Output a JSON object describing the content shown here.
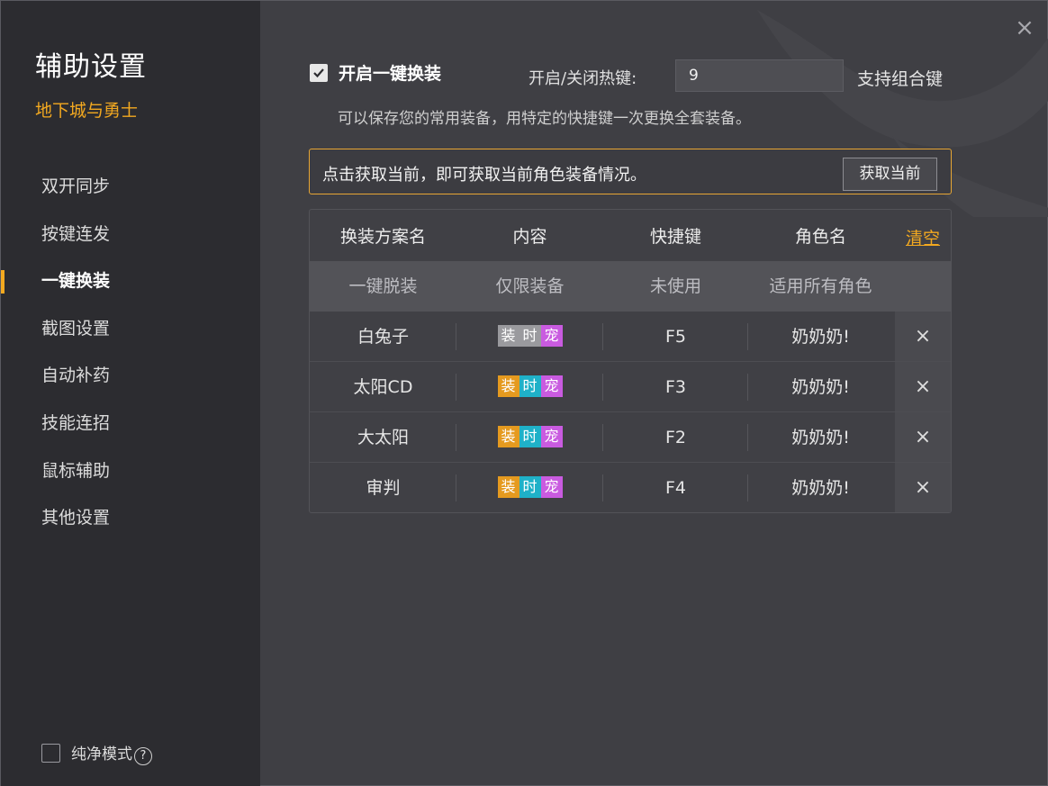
{
  "sidebar": {
    "title": "辅助设置",
    "game": "地下城与勇士",
    "items": [
      {
        "label": "双开同步"
      },
      {
        "label": "按键连发"
      },
      {
        "label": "一键换装"
      },
      {
        "label": "截图设置"
      },
      {
        "label": "自动补药"
      },
      {
        "label": "技能连招"
      },
      {
        "label": "鼠标辅助"
      },
      {
        "label": "其他设置"
      }
    ],
    "active_index": 2,
    "pure_mode_label": "纯净模式",
    "help_glyph": "?"
  },
  "window": {
    "close_glyph": "×"
  },
  "settings": {
    "enable_label": "开启一键换装",
    "enabled": true,
    "hotkey_label": "开启/关闭热键:",
    "hotkey_value": "9",
    "combo_label": "支持组合键",
    "description": "可以保存您的常用装备，用特定的快捷键一次更换全套装备。"
  },
  "notice": {
    "text": "点击获取当前，即可获取当前角色装备情况。",
    "button_label": "获取当前"
  },
  "table": {
    "headers": [
      "换装方案名",
      "内容",
      "快捷键",
      "角色名"
    ],
    "clear_label": "清空",
    "default_row": {
      "name": "一键脱装",
      "content": "仅限装备",
      "hotkey": "未使用",
      "role": "适用所有角色"
    },
    "tag_labels": {
      "equip": "装",
      "time": "时",
      "pet": "宠"
    },
    "delete_glyph": "×",
    "rows": [
      {
        "name": "白兔子",
        "hotkey": "F5",
        "role": "奶奶奶!",
        "equip_active": false,
        "time_active": false
      },
      {
        "name": "太阳CD",
        "hotkey": "F3",
        "role": "奶奶奶!",
        "equip_active": true,
        "time_active": true
      },
      {
        "name": "大太阳",
        "hotkey": "F2",
        "role": "奶奶奶!",
        "equip_active": true,
        "time_active": true
      },
      {
        "name": "审判",
        "hotkey": "F4",
        "role": "奶奶奶!",
        "equip_active": true,
        "time_active": true
      }
    ]
  },
  "colors": {
    "accent": "#f3a920",
    "tag_equip": "#e59a1f",
    "tag_time": "#1fb1c8",
    "tag_pet": "#c95be0",
    "tag_inactive": "#9a9a9e"
  }
}
